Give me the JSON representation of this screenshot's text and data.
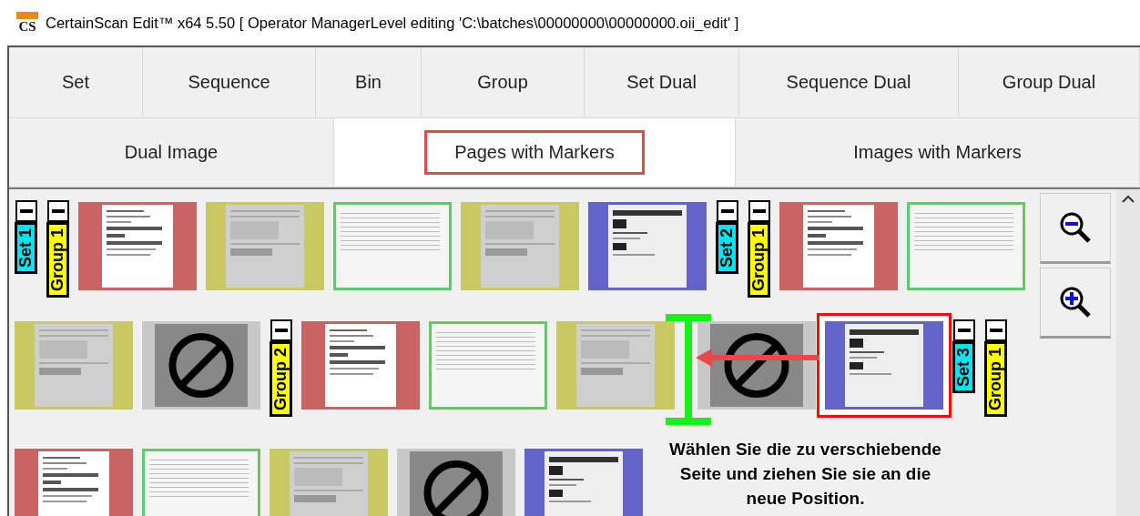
{
  "window": {
    "icon_label": "CS",
    "title": "CertainScan Edit™ x64 5.50  [ Operator ManagerLevel editing 'C:\\batches\\00000000\\00000000.oii_edit' ]"
  },
  "tab_rows": [
    [
      {
        "label": "Set",
        "selected": false,
        "highlighted": false
      },
      {
        "label": "Sequence",
        "selected": false,
        "highlighted": false
      },
      {
        "label": "Bin",
        "selected": false,
        "highlighted": false
      },
      {
        "label": "Group",
        "selected": false,
        "highlighted": false
      },
      {
        "label": "Set Dual",
        "selected": false,
        "highlighted": false
      },
      {
        "label": "Sequence Dual",
        "selected": false,
        "highlighted": false
      },
      {
        "label": "Group Dual",
        "selected": false,
        "highlighted": false
      }
    ],
    [
      {
        "label": "Dual Image",
        "selected": false,
        "highlighted": false
      },
      {
        "label": "Pages with Markers",
        "selected": true,
        "highlighted": true
      },
      {
        "label": "Images with Markers",
        "selected": false,
        "highlighted": false
      }
    ]
  ],
  "thumbnail_rows": [
    [
      {
        "kind": "marker",
        "color": "#00e6f0",
        "label": "Set 1"
      },
      {
        "kind": "marker",
        "color": "#ffff00",
        "label": "Group 1"
      },
      {
        "kind": "form",
        "color": "#c86464",
        "selected": false
      },
      {
        "kind": "copy",
        "color": "#c8c864",
        "selected": false
      },
      {
        "kind": "table",
        "color": "#64c864",
        "selected": false
      },
      {
        "kind": "copy",
        "color": "#c8c864",
        "selected": false
      },
      {
        "kind": "separator",
        "color": "#6464c8",
        "selected": false
      },
      {
        "kind": "marker",
        "color": "#00e6f0",
        "label": "Set 2"
      },
      {
        "kind": "marker",
        "color": "#ffff00",
        "label": "Group 1"
      },
      {
        "kind": "form",
        "color": "#c86464",
        "selected": false
      },
      {
        "kind": "table",
        "color": "#64c864",
        "selected": false
      }
    ],
    [
      {
        "kind": "copy",
        "color": "#c8c864",
        "selected": false
      },
      {
        "kind": "blocked",
        "color": "#c8c8c8",
        "selected": false
      },
      {
        "kind": "marker",
        "color": "#ffff00",
        "label": "Group 2"
      },
      {
        "kind": "form",
        "color": "#c86464",
        "selected": false
      },
      {
        "kind": "table",
        "color": "#64c864",
        "selected": false
      },
      {
        "kind": "copy",
        "color": "#c8c864",
        "selected": false
      },
      {
        "kind": "insert"
      },
      {
        "kind": "blocked",
        "color": "#c8c8c8",
        "selected": false
      },
      {
        "kind": "separator",
        "color": "#6464c8",
        "selected": true
      },
      {
        "kind": "marker",
        "color": "#00e6f0",
        "label": "Set 3"
      },
      {
        "kind": "marker",
        "color": "#ffff00",
        "label": "Group 1"
      }
    ],
    [
      {
        "kind": "form",
        "color": "#c86464",
        "selected": false
      },
      {
        "kind": "table",
        "color": "#64c864",
        "selected": false
      },
      {
        "kind": "copy",
        "color": "#c8c864",
        "selected": false
      },
      {
        "kind": "blocked",
        "color": "#c8c8c8",
        "selected": false
      },
      {
        "kind": "separator",
        "color": "#6464c8",
        "selected": false
      }
    ]
  ],
  "hint": "Wählen Sie die zu verschiebende Seite und ziehen Sie sie an die neue Position."
}
